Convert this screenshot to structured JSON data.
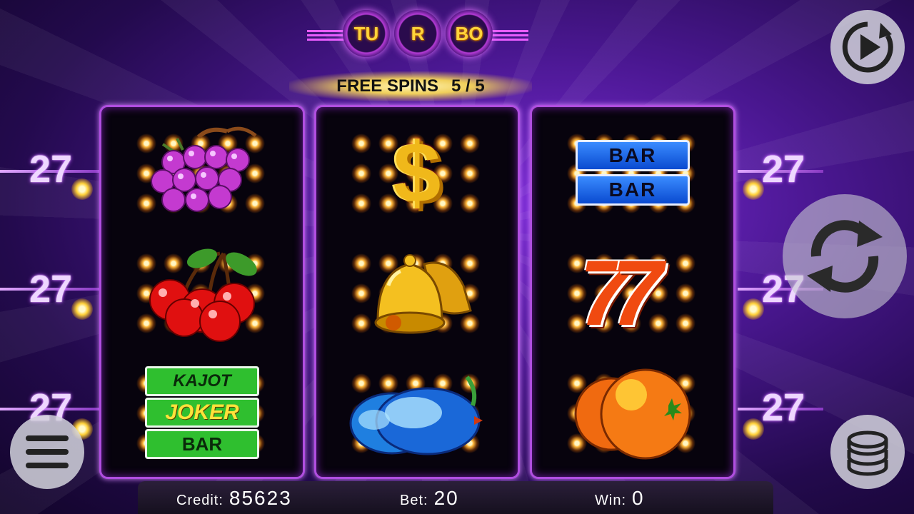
{
  "logo": {
    "letters": [
      "TU",
      "R",
      "BO"
    ]
  },
  "free_spins": {
    "label": "FREE SPINS",
    "value": "5 / 5"
  },
  "paylines": {
    "left": [
      "27",
      "27",
      "27"
    ],
    "right": [
      "27",
      "27",
      "27"
    ]
  },
  "reels": [
    {
      "symbols": [
        "grapes",
        "cherries",
        "kajot-joker-bar"
      ]
    },
    {
      "symbols": [
        "dollar",
        "bells",
        "plums"
      ]
    },
    {
      "symbols": [
        "double-bar",
        "sevens",
        "oranges"
      ]
    }
  ],
  "symbol_text": {
    "dollar": "$",
    "kajot": "KAJOT",
    "joker": "JOKER",
    "bar": "BAR",
    "seven": "7"
  },
  "status": {
    "credit_label": "Credit:",
    "credit_value": "85623",
    "bet_label": "Bet:",
    "bet_value": "20",
    "win_label": "Win:",
    "win_value": "0"
  },
  "buttons": {
    "autoplay": "autoplay-icon",
    "spin": "spin-icon",
    "menu": "menu-icon",
    "bet": "chips-icon"
  },
  "colors": {
    "accent": "#b04ee0",
    "glow": "#ffb63a",
    "background": "#4a1791"
  }
}
